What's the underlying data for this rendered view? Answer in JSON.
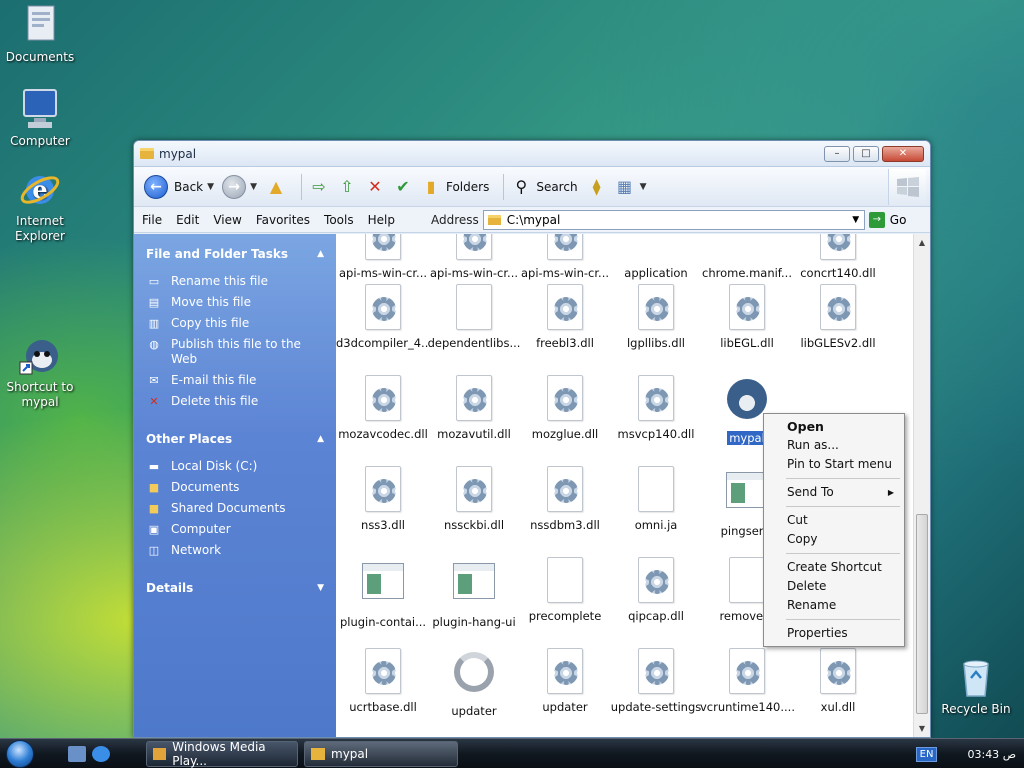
{
  "desktop": {
    "icons": [
      {
        "label": "Documents"
      },
      {
        "label": "Computer"
      },
      {
        "label": "Internet Explorer"
      },
      {
        "label": "Shortcut to mypal"
      },
      {
        "label": "Recycle Bin"
      }
    ]
  },
  "window": {
    "title": "mypal",
    "controls": {
      "minimize": "–",
      "maximize": "□",
      "close": "✕"
    },
    "toolbar": {
      "back": "Back",
      "folders": "Folders",
      "search": "Search"
    },
    "menu": [
      "File",
      "Edit",
      "View",
      "Favorites",
      "Tools",
      "Help"
    ],
    "address": {
      "label": "Address",
      "value": "C:\\mypal",
      "go": "Go"
    }
  },
  "taskpane": {
    "file_tasks": {
      "title": "File and Folder Tasks",
      "items": [
        {
          "label": "Rename this file",
          "icon": "rename-icon"
        },
        {
          "label": "Move this file",
          "icon": "move-icon"
        },
        {
          "label": "Copy this file",
          "icon": "copy-icon"
        },
        {
          "label": "Publish this file to the Web",
          "icon": "publish-icon"
        },
        {
          "label": "E-mail this file",
          "icon": "email-icon"
        },
        {
          "label": "Delete this file",
          "icon": "delete-icon"
        }
      ]
    },
    "other_places": {
      "title": "Other Places",
      "items": [
        {
          "label": "Local Disk (C:)",
          "icon": "disk-icon"
        },
        {
          "label": "Documents",
          "icon": "folder-icon"
        },
        {
          "label": "Shared Documents",
          "icon": "folder-icon"
        },
        {
          "label": "Computer",
          "icon": "computer-icon"
        },
        {
          "label": "Network",
          "icon": "network-icon"
        }
      ]
    },
    "details": {
      "title": "Details"
    }
  },
  "files": {
    "row0": [
      "api-ms-win-cr...",
      "api-ms-win-cr...",
      "api-ms-win-cr...",
      "application",
      "chrome.manif...",
      "concrt140.dll"
    ],
    "row1": [
      "d3dcompiler_4...",
      "dependentlibs...",
      "freebl3.dll",
      "lgpllibs.dll",
      "libEGL.dll",
      "libGLESv2.dll"
    ],
    "row2": [
      "mozavcodec.dll",
      "mozavutil.dll",
      "mozglue.dll",
      "msvcp140.dll",
      "mypal",
      ""
    ],
    "row3": [
      "nss3.dll",
      "nssckbi.dll",
      "nssdbm3.dll",
      "omni.ja",
      "pingsend",
      ""
    ],
    "row4": [
      "plugin-contai...",
      "plugin-hang-ui",
      "precomplete",
      "qipcap.dll",
      "removed-",
      ""
    ],
    "row5": [
      "ucrtbase.dll",
      "updater",
      "updater",
      "update-settings",
      "vcruntime140....",
      "xul.dll"
    ]
  },
  "context_menu": {
    "items": [
      "Open",
      "Run as...",
      "Pin to Start menu",
      "Send To",
      "Cut",
      "Copy",
      "Create Shortcut",
      "Delete",
      "Rename",
      "Properties"
    ]
  },
  "taskbar": {
    "buttons": [
      "Windows Media Play...",
      "mypal"
    ],
    "lang": "EN",
    "clock": "03:43 ص"
  },
  "colors": {
    "selection": "#3168c6",
    "taskpane": "#5c84d4"
  }
}
